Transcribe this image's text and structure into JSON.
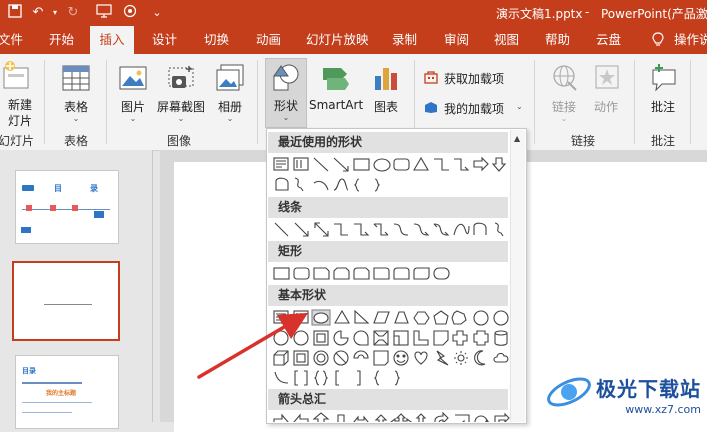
{
  "titlebar": {
    "left_fragment": "文件",
    "doc_title": "演示文稿1.pptx",
    "separator": "-",
    "app_title": "PowerPoint(产品激",
    "icons": [
      "undo-icon",
      "redo-icon",
      "present-from-beginning-icon",
      "touch-mode-icon",
      "customize-qat-icon"
    ]
  },
  "tabs": [
    {
      "label": "文件"
    },
    {
      "label": "开始"
    },
    {
      "label": "插入"
    },
    {
      "label": "设计"
    },
    {
      "label": "切换"
    },
    {
      "label": "动画"
    },
    {
      "label": "幻灯片放映"
    },
    {
      "label": "录制"
    },
    {
      "label": "审阅"
    },
    {
      "label": "视图"
    },
    {
      "label": "帮助"
    },
    {
      "label": "云盘"
    },
    {
      "label": "操作说"
    }
  ],
  "active_tab": "插入",
  "ribbon": {
    "new_slide": {
      "line1": "新建",
      "line2": "灯片"
    },
    "table": {
      "label": "表格"
    },
    "picture": {
      "label": "图片"
    },
    "screenshot": {
      "label": "屏幕截图"
    },
    "album": {
      "label": "相册"
    },
    "shapes": {
      "line1": "形状"
    },
    "smartart": {
      "label": "SmartArt"
    },
    "chart": {
      "label": "图表"
    },
    "get_addins": {
      "label": "获取加载项"
    },
    "my_addins": {
      "label": "我的加载项"
    },
    "link": {
      "label": "链接"
    },
    "action": {
      "label": "动作"
    },
    "comment": {
      "label": "批注"
    },
    "groups": {
      "slides": "幻灯片",
      "tables": "表格",
      "images": "图像",
      "links": "链接",
      "comments": "批注"
    }
  },
  "shapes_gallery": {
    "sections": [
      {
        "title": "最近使用的形状"
      },
      {
        "title": "线条"
      },
      {
        "title": "矩形"
      },
      {
        "title": "基本形状"
      },
      {
        "title": "箭头总汇"
      }
    ]
  },
  "thumbnails": {
    "slide1": {
      "heading": "目",
      "heading2": "录"
    },
    "slide3": {
      "heading": "目录",
      "highlight": "我的主标题"
    }
  },
  "watermark": {
    "brand": "极光下载站",
    "url": "www.xz7.com"
  },
  "colors": {
    "accent": "#c43e1c",
    "ribbon_bg": "#f3f3f3",
    "arrow": "#d9312b",
    "section_bg": "#e1e1e1"
  }
}
